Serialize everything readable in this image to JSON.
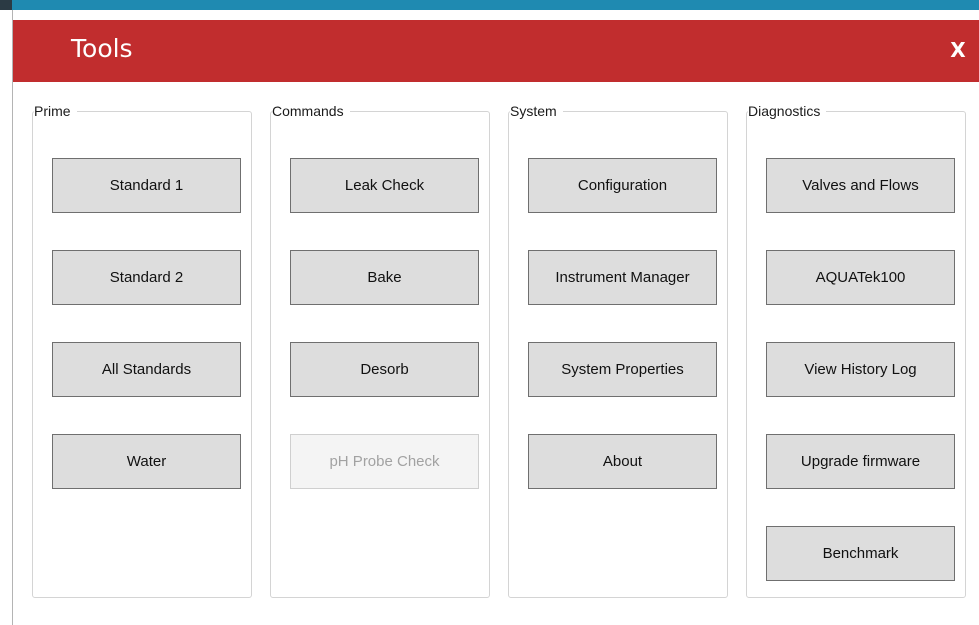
{
  "window": {
    "title": "Tools",
    "close_label": "X"
  },
  "groups": {
    "prime": {
      "label": "Prime",
      "buttons": [
        "Standard 1",
        "Standard 2",
        "All Standards",
        "Water"
      ]
    },
    "commands": {
      "label": "Commands",
      "buttons": [
        "Leak Check",
        "Bake",
        "Desorb",
        "pH Probe Check"
      ],
      "disabled": [
        "pH Probe Check"
      ]
    },
    "system": {
      "label": "System",
      "buttons": [
        "Configuration",
        "Instrument Manager",
        "System Properties",
        "About"
      ]
    },
    "diagnostics": {
      "label": "Diagnostics",
      "buttons": [
        "Valves and Flows",
        "AQUATek100",
        "View History Log",
        "Upgrade firmware",
        "Benchmark"
      ]
    }
  },
  "colors": {
    "titlebar": "#c12d2e",
    "accent_strip": "#1f8ab1",
    "button_face": "#dddddd",
    "button_border": "#6f6f6f",
    "disabled_text": "#a2a2a2"
  }
}
